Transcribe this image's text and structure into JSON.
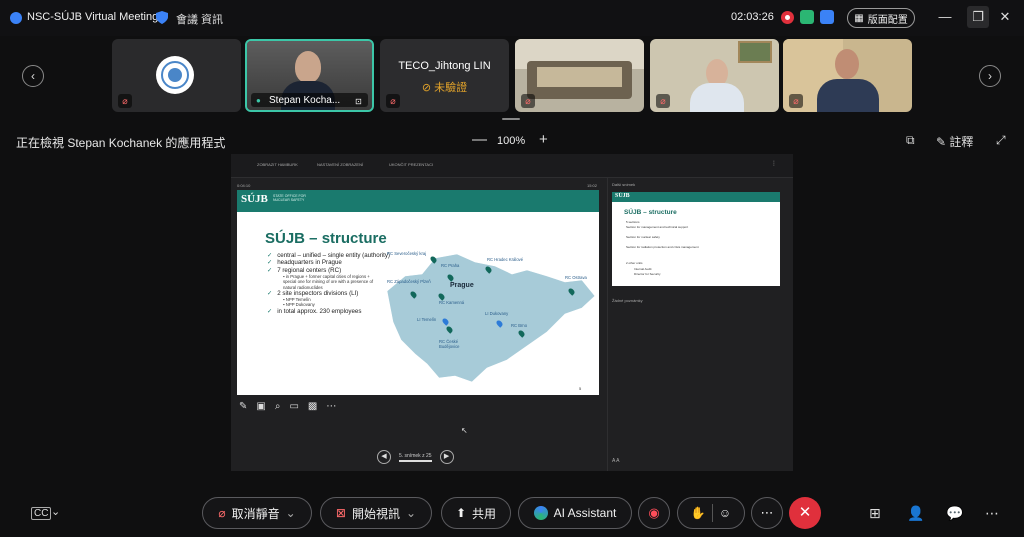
{
  "titlebar": {
    "app_title": "NSC-SÚJB Virtual Meeting",
    "meeting_info": "會議 資訊",
    "timer": "02:03:26",
    "layout_button": "版面配置",
    "minimize": "—",
    "restore": "❐",
    "close": "✕"
  },
  "participants": [
    {
      "name": "",
      "type": "logo"
    },
    {
      "name": "Stepan Kocha...",
      "active": true
    },
    {
      "name": "TECO_Jihtong LIN",
      "status": "未驗證"
    },
    {
      "name": "",
      "type": "room"
    },
    {
      "name": "",
      "type": "person"
    },
    {
      "name": "",
      "type": "person"
    }
  ],
  "viewbar": {
    "viewing_label": "正在檢視 Stepan Kochanek 的應用程式",
    "zoom": "100%",
    "minus": "—",
    "plus": "+",
    "annotate": "註釋"
  },
  "presenter": {
    "toolbar": [
      "ZOBRAZIT HAMBURK",
      "NASTAVENÍ ZOBRAZENÍ",
      "UKONČIT PREZENTACI"
    ],
    "elapsed": "0:04:10",
    "clock": "15:02",
    "next_slide_label": "Další snímek",
    "notes": "Žádné poznámky",
    "pager": "5. snímek z 25"
  },
  "slide": {
    "logo": "SÚJB",
    "logo_sub": "STATE OFFICE FOR NUCLEAR SAFETY",
    "title": "SÚJB – structure",
    "bullets": [
      {
        "text": "central – unified – single entity (authority)",
        "level": 1
      },
      {
        "text": "headquarters in Prague",
        "level": 1
      },
      {
        "text": "7 regional centers (RC)",
        "level": 1
      },
      {
        "text": "in Prague + former capital cities of regions + special one for mining of ore with a presence of natural radionuclides",
        "level": 2
      },
      {
        "text": "2 site inspectors divisions (LI)",
        "level": 1
      },
      {
        "text": "NPP Temelín",
        "level": 2
      },
      {
        "text": "NPP Dukovany",
        "level": 2
      },
      {
        "text": "in total approx. 230 employees",
        "level": 1
      }
    ],
    "map_labels": {
      "prague": "Prague",
      "rc_severoceske": "RC Severočeský kraj",
      "rc_hradec": "RC Hradec Králové",
      "rc_ostrava": "RC Ostrava",
      "rc_plzen": "RC Západočeský Plzeň",
      "rc_kamenna": "RC Kamenná",
      "li_temelin": "LI Temelín",
      "li_dukovany": "LI Dukovany",
      "rc_brno": "RC Brno",
      "rc_cb": "RC České Budějovice",
      "rc_praha": "RC Praha"
    }
  },
  "next_slide": {
    "title": "SÚJB – structure",
    "lines": [
      "5 sections",
      "Section for management and technical support",
      "Section for nuclear safety",
      "Section for radiation protection and crisis management",
      "2 other units",
      "Internal Audit",
      "Director for Security"
    ]
  },
  "controls": {
    "mute": "取消靜音",
    "video": "開始視訊",
    "share": "共用",
    "ai": "AI Assistant"
  },
  "colors": {
    "accent": "#3cc7a8",
    "slide_green": "#1a7a6e",
    "end_red": "#e0303c"
  }
}
